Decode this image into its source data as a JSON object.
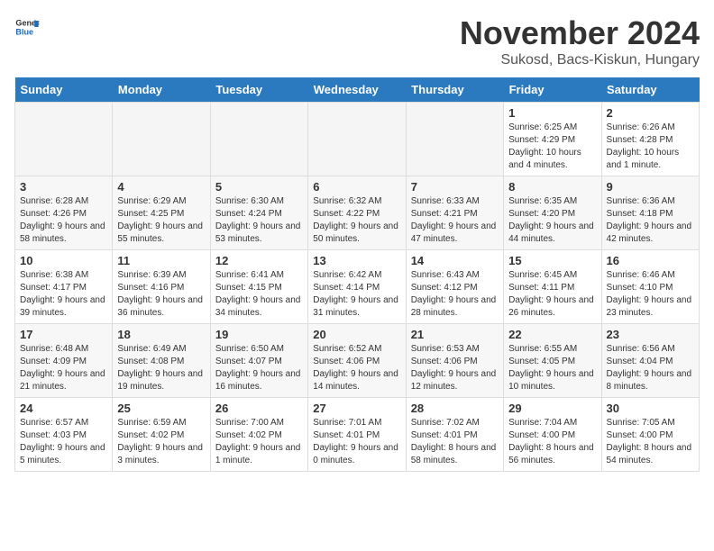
{
  "header": {
    "logo_general": "General",
    "logo_blue": "Blue",
    "month_title": "November 2024",
    "location": "Sukosd, Bacs-Kiskun, Hungary"
  },
  "days_of_week": [
    "Sunday",
    "Monday",
    "Tuesday",
    "Wednesday",
    "Thursday",
    "Friday",
    "Saturday"
  ],
  "weeks": [
    [
      {
        "day": "",
        "empty": true
      },
      {
        "day": "",
        "empty": true
      },
      {
        "day": "",
        "empty": true
      },
      {
        "day": "",
        "empty": true
      },
      {
        "day": "",
        "empty": true
      },
      {
        "day": "1",
        "info": "Sunrise: 6:25 AM\nSunset: 4:29 PM\nDaylight: 10 hours and 4 minutes."
      },
      {
        "day": "2",
        "info": "Sunrise: 6:26 AM\nSunset: 4:28 PM\nDaylight: 10 hours and 1 minute."
      }
    ],
    [
      {
        "day": "3",
        "info": "Sunrise: 6:28 AM\nSunset: 4:26 PM\nDaylight: 9 hours and 58 minutes."
      },
      {
        "day": "4",
        "info": "Sunrise: 6:29 AM\nSunset: 4:25 PM\nDaylight: 9 hours and 55 minutes."
      },
      {
        "day": "5",
        "info": "Sunrise: 6:30 AM\nSunset: 4:24 PM\nDaylight: 9 hours and 53 minutes."
      },
      {
        "day": "6",
        "info": "Sunrise: 6:32 AM\nSunset: 4:22 PM\nDaylight: 9 hours and 50 minutes."
      },
      {
        "day": "7",
        "info": "Sunrise: 6:33 AM\nSunset: 4:21 PM\nDaylight: 9 hours and 47 minutes."
      },
      {
        "day": "8",
        "info": "Sunrise: 6:35 AM\nSunset: 4:20 PM\nDaylight: 9 hours and 44 minutes."
      },
      {
        "day": "9",
        "info": "Sunrise: 6:36 AM\nSunset: 4:18 PM\nDaylight: 9 hours and 42 minutes."
      }
    ],
    [
      {
        "day": "10",
        "info": "Sunrise: 6:38 AM\nSunset: 4:17 PM\nDaylight: 9 hours and 39 minutes."
      },
      {
        "day": "11",
        "info": "Sunrise: 6:39 AM\nSunset: 4:16 PM\nDaylight: 9 hours and 36 minutes."
      },
      {
        "day": "12",
        "info": "Sunrise: 6:41 AM\nSunset: 4:15 PM\nDaylight: 9 hours and 34 minutes."
      },
      {
        "day": "13",
        "info": "Sunrise: 6:42 AM\nSunset: 4:14 PM\nDaylight: 9 hours and 31 minutes."
      },
      {
        "day": "14",
        "info": "Sunrise: 6:43 AM\nSunset: 4:12 PM\nDaylight: 9 hours and 28 minutes."
      },
      {
        "day": "15",
        "info": "Sunrise: 6:45 AM\nSunset: 4:11 PM\nDaylight: 9 hours and 26 minutes."
      },
      {
        "day": "16",
        "info": "Sunrise: 6:46 AM\nSunset: 4:10 PM\nDaylight: 9 hours and 23 minutes."
      }
    ],
    [
      {
        "day": "17",
        "info": "Sunrise: 6:48 AM\nSunset: 4:09 PM\nDaylight: 9 hours and 21 minutes."
      },
      {
        "day": "18",
        "info": "Sunrise: 6:49 AM\nSunset: 4:08 PM\nDaylight: 9 hours and 19 minutes."
      },
      {
        "day": "19",
        "info": "Sunrise: 6:50 AM\nSunset: 4:07 PM\nDaylight: 9 hours and 16 minutes."
      },
      {
        "day": "20",
        "info": "Sunrise: 6:52 AM\nSunset: 4:06 PM\nDaylight: 9 hours and 14 minutes."
      },
      {
        "day": "21",
        "info": "Sunrise: 6:53 AM\nSunset: 4:06 PM\nDaylight: 9 hours and 12 minutes."
      },
      {
        "day": "22",
        "info": "Sunrise: 6:55 AM\nSunset: 4:05 PM\nDaylight: 9 hours and 10 minutes."
      },
      {
        "day": "23",
        "info": "Sunrise: 6:56 AM\nSunset: 4:04 PM\nDaylight: 9 hours and 8 minutes."
      }
    ],
    [
      {
        "day": "24",
        "info": "Sunrise: 6:57 AM\nSunset: 4:03 PM\nDaylight: 9 hours and 5 minutes."
      },
      {
        "day": "25",
        "info": "Sunrise: 6:59 AM\nSunset: 4:02 PM\nDaylight: 9 hours and 3 minutes."
      },
      {
        "day": "26",
        "info": "Sunrise: 7:00 AM\nSunset: 4:02 PM\nDaylight: 9 hours and 1 minute."
      },
      {
        "day": "27",
        "info": "Sunrise: 7:01 AM\nSunset: 4:01 PM\nDaylight: 9 hours and 0 minutes."
      },
      {
        "day": "28",
        "info": "Sunrise: 7:02 AM\nSunset: 4:01 PM\nDaylight: 8 hours and 58 minutes."
      },
      {
        "day": "29",
        "info": "Sunrise: 7:04 AM\nSunset: 4:00 PM\nDaylight: 8 hours and 56 minutes."
      },
      {
        "day": "30",
        "info": "Sunrise: 7:05 AM\nSunset: 4:00 PM\nDaylight: 8 hours and 54 minutes."
      }
    ]
  ]
}
